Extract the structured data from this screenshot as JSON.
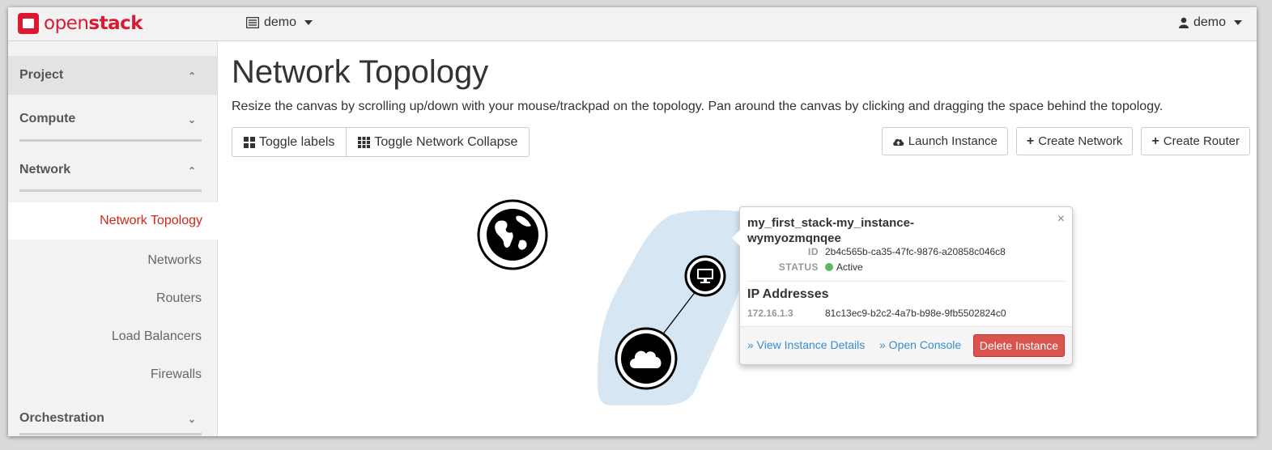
{
  "brand": {
    "name_plain": "open",
    "name_bold": "stack"
  },
  "header": {
    "project_label": "demo",
    "user_label": "demo"
  },
  "sidebar": {
    "sections": [
      {
        "label": "Project"
      },
      {
        "label": "Compute"
      },
      {
        "label": "Network"
      },
      {
        "label": "Orchestration"
      }
    ],
    "items": [
      {
        "label": "Network Topology"
      },
      {
        "label": "Networks"
      },
      {
        "label": "Routers"
      },
      {
        "label": "Load Balancers"
      },
      {
        "label": "Firewalls"
      }
    ]
  },
  "main": {
    "title": "Network Topology",
    "description": "Resize the canvas by scrolling up/down with your mouse/trackpad on the topology. Pan around the canvas by clicking and dragging the space behind the topology.",
    "toggle_labels": "Toggle labels",
    "toggle_collapse": "Toggle Network Collapse",
    "launch_instance": "Launch Instance",
    "create_network": "Create Network",
    "create_router": "Create Router"
  },
  "popup": {
    "name_line1": "my_first_stack-my_instance-",
    "name_line2": "wymyozmqnqee",
    "close": "×",
    "id_label": "ID",
    "id_value": "2b4c565b-ca35-47fc-9876-a20858c046c8",
    "status_label": "STATUS",
    "status_value": "Active",
    "ip_heading": "IP Addresses",
    "ip": "172.16.1.3",
    "port_id": "81c13ec9-b2c2-4a7b-b98e-9fb5502824c0",
    "view_details": "» View Instance Details",
    "open_console": "» Open Console",
    "delete": "Delete Instance"
  },
  "colors": {
    "brand_red": "#da1a32",
    "active_link": "#d2251d",
    "link_blue": "#3c8dca",
    "danger": "#d9534f",
    "network_fill": "#d6e6f3",
    "status_green": "#5cb85c"
  },
  "icons": {
    "external_network": "globe-icon",
    "instance": "monitor-icon",
    "router": "cloud-icon"
  }
}
